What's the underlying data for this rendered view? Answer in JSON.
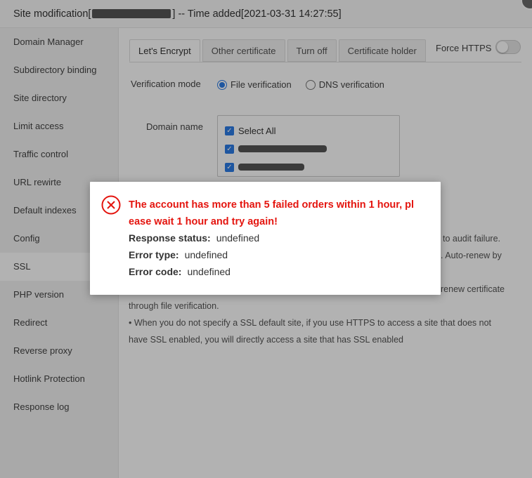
{
  "window": {
    "title_prefix": "Site modification[",
    "title_suffix": "] -- Time added[2021-03-31 14:27:55]"
  },
  "sidebar": {
    "items": [
      {
        "label": "Domain Manager"
      },
      {
        "label": "Subdirectory binding"
      },
      {
        "label": "Site directory"
      },
      {
        "label": "Limit access"
      },
      {
        "label": "Traffic control"
      },
      {
        "label": "URL rewirte"
      },
      {
        "label": "Default indexes"
      },
      {
        "label": "Config"
      },
      {
        "label": "SSL"
      },
      {
        "label": "PHP version"
      },
      {
        "label": "Redirect"
      },
      {
        "label": "Reverse proxy"
      },
      {
        "label": "Hotlink Protection"
      },
      {
        "label": "Response log"
      }
    ],
    "active": "SSL"
  },
  "tabs": [
    {
      "label": "Let's Encrypt"
    },
    {
      "label": "Other certificate"
    },
    {
      "label": "Turn off"
    },
    {
      "label": "Certificate holder"
    }
  ],
  "force_https": {
    "label": "Force HTTPS",
    "enabled": false
  },
  "verification": {
    "label": "Verification mode",
    "options": [
      {
        "label": "File verification",
        "selected": true
      },
      {
        "label": "DNS verification",
        "selected": false
      }
    ]
  },
  "domain": {
    "label": "Domain name",
    "select_all": "Select All"
  },
  "notes": {
    "frag1": "to audit failure.",
    "frag2": ". Auto-renew by",
    "frag3": "renew certificate",
    "line4": "through file verification.",
    "line5": "•  When you do not specify a SSL default site, if you use HTTPS to access a site that does not",
    "line6": "have SSL enabled, you will directly access a site that has SSL enabled"
  },
  "modal": {
    "message_line1": "The account has more than 5 failed orders within 1 hour, pl",
    "message_line2": "ease wait 1 hour and try again!",
    "status_label": "Response status:",
    "status_value": "undefined",
    "type_label": "Error type:",
    "type_value": "undefined",
    "code_label": "Error code:",
    "code_value": "undefined"
  },
  "colors": {
    "accent": "#2c7be5",
    "error": "#e4150f"
  }
}
